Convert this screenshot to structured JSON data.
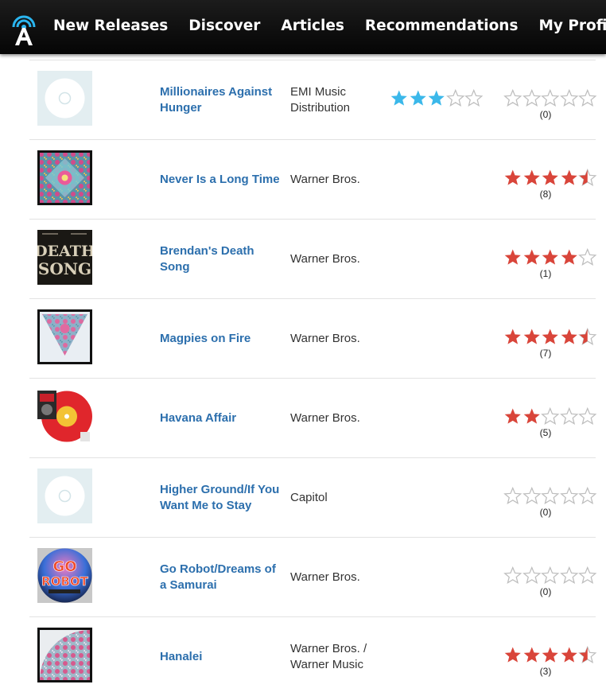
{
  "nav": {
    "logo": "antenna-a-logo",
    "items": [
      "New Releases",
      "Discover",
      "Articles",
      "Recommendations",
      "My Profile"
    ]
  },
  "colors": {
    "nav_bg": "#0d0d0d",
    "title": "#2c6fad",
    "critic_star": "#3bb8ea",
    "user_star": "#d9453a",
    "empty_star": "#bdbdbd"
  },
  "rows": [
    {
      "title": "Millionaires Against Hunger",
      "label": "EMI Music Distribution",
      "cover": "blank-disc-placeholder",
      "critic_rating": 3,
      "user_rating": 0,
      "user_count": "(0)"
    },
    {
      "title": "Never Is a Long Time",
      "label": "Warner Bros.",
      "cover": "psychedelic-mandala-art",
      "critic_rating": null,
      "user_rating": 4.5,
      "user_count": "(8)"
    },
    {
      "title": "Brendan's Death Song",
      "label": "Warner Bros.",
      "cover": "death-song-lettering-art",
      "critic_rating": null,
      "user_rating": 4,
      "user_count": "(1)"
    },
    {
      "title": "Magpies on Fire",
      "label": "Warner Bros.",
      "cover": "psychedelic-triangle-art",
      "critic_rating": null,
      "user_rating": 4.5,
      "user_count": "(7)"
    },
    {
      "title": "Havana Affair",
      "label": "Warner Bros.",
      "cover": "red-vinyl-single-art",
      "critic_rating": null,
      "user_rating": 2,
      "user_count": "(5)"
    },
    {
      "title": "Higher Ground/If You Want Me to Stay",
      "label": "Capitol",
      "cover": "blank-disc-placeholder",
      "critic_rating": null,
      "user_rating": 0,
      "user_count": "(0)"
    },
    {
      "title": "Go Robot/Dreams of a Samurai",
      "label": "Warner Bros.",
      "cover": "go-robot-lettering-art",
      "critic_rating": null,
      "user_rating": 0,
      "user_count": "(0)"
    },
    {
      "title": "Hanalei",
      "label": "Warner Bros. / Warner Music",
      "cover": "psychedelic-corner-art",
      "critic_rating": null,
      "user_rating": 4.5,
      "user_count": "(3)"
    }
  ]
}
